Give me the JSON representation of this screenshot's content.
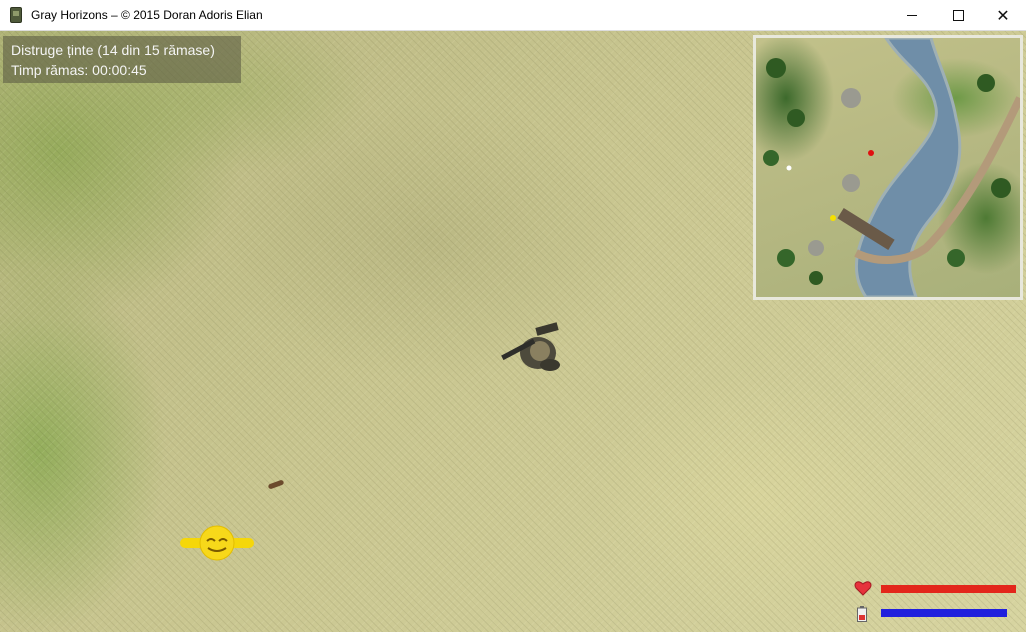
{
  "window": {
    "title": "Gray Horizons – © 2015 Doran Adoris Elian",
    "minimize_glyph": "",
    "maximize_glyph": "",
    "close_glyph": "✕"
  },
  "hud": {
    "objective": "Distruge ținte (14 din 15 rămase)",
    "time_left": "Timp rămas: 00:00:45"
  },
  "status": {
    "health_fraction": 1.0,
    "energy_fraction": 0.93,
    "health_color": "#e3261b",
    "energy_color": "#2020dd",
    "health_icon": "heart-icon",
    "energy_icon": "battery-icon"
  },
  "minimap": {
    "markers": [
      {
        "name": "enemy-marker",
        "color": "#e01010"
      },
      {
        "name": "player-marker",
        "color": "#f5e000"
      },
      {
        "name": "target-marker",
        "color": "#ffffff"
      }
    ]
  },
  "colors": {
    "grass": "#c9c690",
    "hud_bg": "rgba(95,95,70,0.62)",
    "river": "#6f8ea8"
  }
}
